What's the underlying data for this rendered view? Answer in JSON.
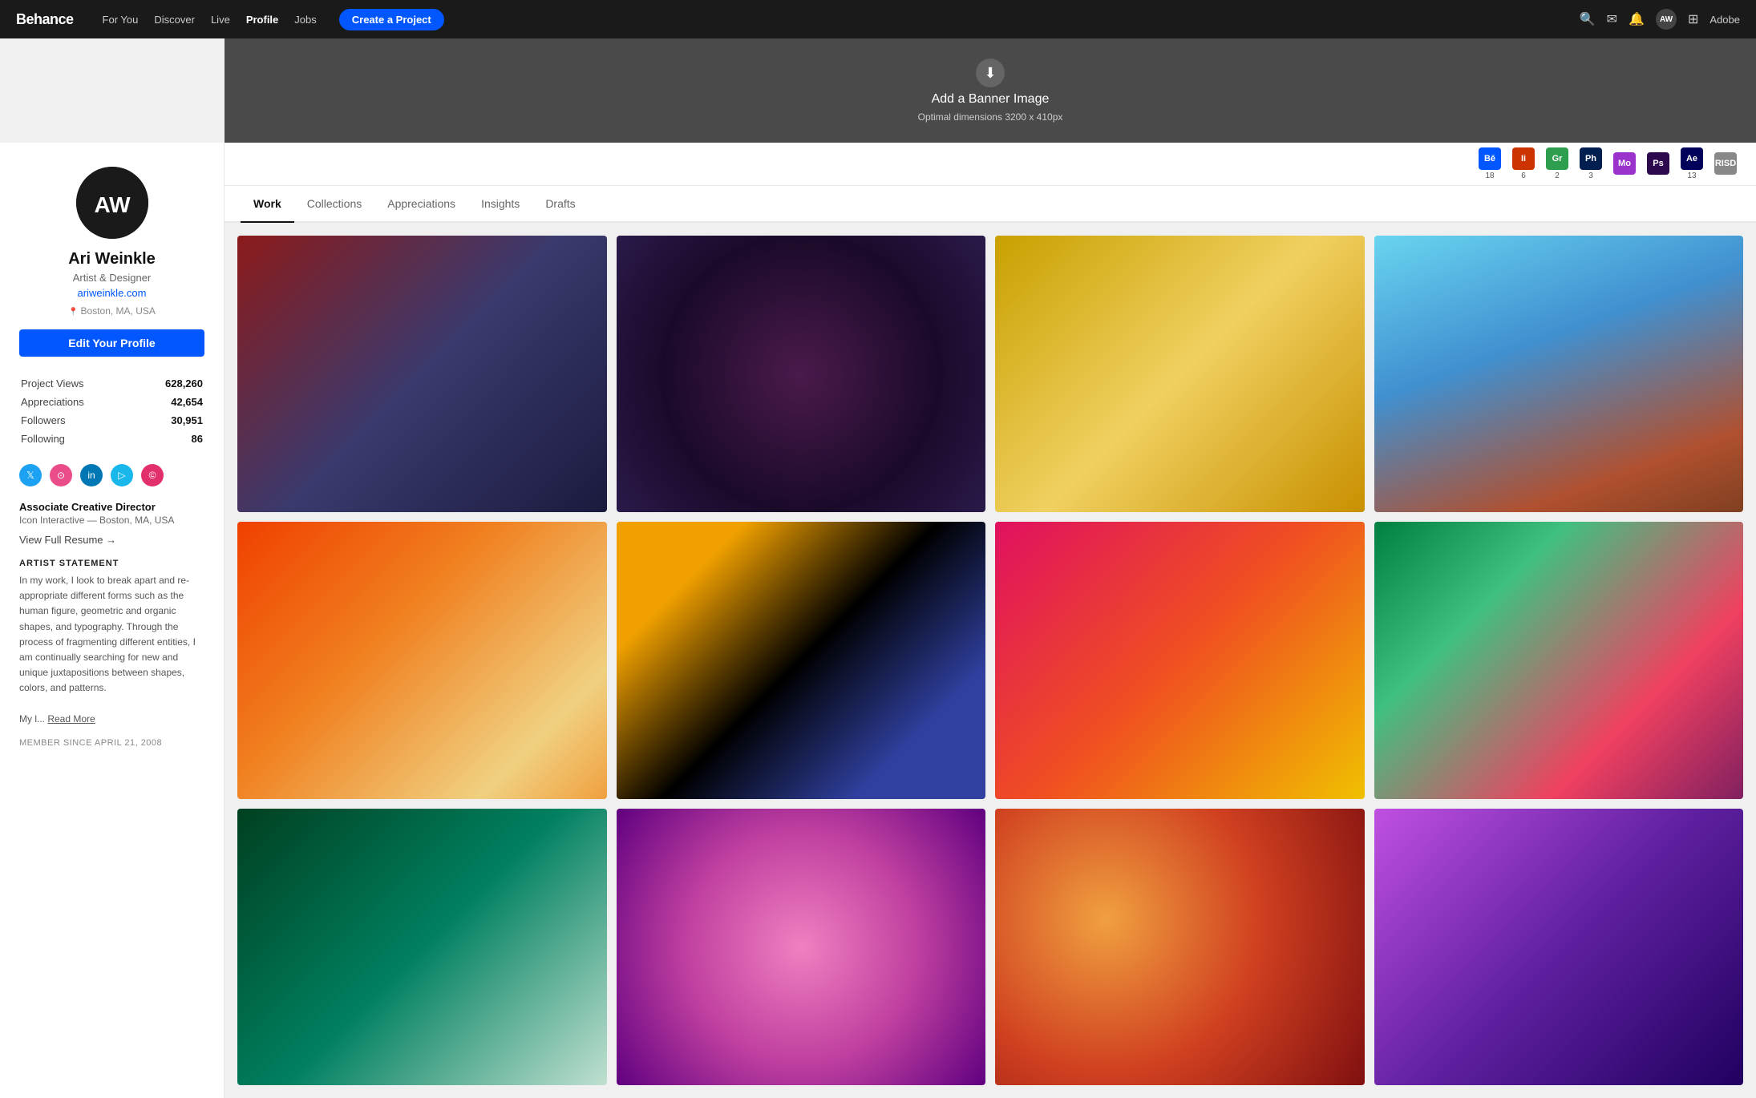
{
  "nav": {
    "brand": "Behance",
    "links": [
      {
        "label": "For You",
        "active": false
      },
      {
        "label": "Discover",
        "active": false
      },
      {
        "label": "Live",
        "active": false
      },
      {
        "label": "Profile",
        "active": true
      },
      {
        "label": "Jobs",
        "active": false
      }
    ],
    "cta": "Create a Project",
    "adobe": "Adobe"
  },
  "banner": {
    "title": "Add a Banner Image",
    "subtitle": "Optimal dimensions 3200 x 410px"
  },
  "sidebar": {
    "avatar_initials": "AW",
    "name": "Ari Weinkle",
    "role": "Artist & Designer",
    "website": "ariweinkle.com",
    "location": "Boston, MA, USA",
    "edit_profile_label": "Edit Your Profile",
    "stats": [
      {
        "label": "Project Views",
        "value": "628,260"
      },
      {
        "label": "Appreciations",
        "value": "42,654"
      },
      {
        "label": "Followers",
        "value": "30,951"
      },
      {
        "label": "Following",
        "value": "86"
      }
    ],
    "social_icons": [
      "𝕏",
      "⊙",
      "in",
      "▷",
      "©"
    ],
    "job_title": "Associate Creative Director",
    "job_company": "Icon Interactive — Boston, MA, USA",
    "resume_link": "View Full Resume →",
    "artist_statement_title": "ARTIST STATEMENT",
    "artist_statement": "In my work, I look to break apart and re-appropriate different forms such as the human figure, geometric and organic shapes, and typography. Through the process of fragmenting different entities, I am continually searching for new and unique juxtapositions between shapes, colors, and patterns.\n\nMy l...",
    "read_more": "Read More",
    "member_since": "MEMBER SINCE APRIL 21, 2008"
  },
  "badges": [
    {
      "label": "Bē",
      "color": "#0057ff",
      "count": "18"
    },
    {
      "label": "Ii",
      "color": "#cc3300",
      "count": "6"
    },
    {
      "label": "Gr",
      "color": "#00aa44",
      "count": "2"
    },
    {
      "label": "Ph",
      "color": "#0044cc",
      "count": "3"
    },
    {
      "label": "Mo",
      "color": "#9933cc",
      "count": ""
    },
    {
      "label": "Ps",
      "color": "#001e50",
      "count": ""
    },
    {
      "label": "Ae",
      "color": "#00005b",
      "count": "13"
    },
    {
      "label": "RISD",
      "color": "#888888",
      "count": ""
    }
  ],
  "tabs": [
    {
      "label": "Work",
      "active": true
    },
    {
      "label": "Collections",
      "active": false
    },
    {
      "label": "Appreciations",
      "active": false
    },
    {
      "label": "Insights",
      "active": false
    },
    {
      "label": "Drafts",
      "active": false
    }
  ],
  "portfolio": {
    "items": [
      {
        "class": "pi-1"
      },
      {
        "class": "pi-2"
      },
      {
        "class": "pi-3"
      },
      {
        "class": "pi-4"
      },
      {
        "class": "pi-5"
      },
      {
        "class": "pi-6"
      },
      {
        "class": "pi-7"
      },
      {
        "class": "pi-8"
      },
      {
        "class": "pi-9"
      },
      {
        "class": "pi-10"
      },
      {
        "class": "pi-11"
      },
      {
        "class": "pi-12"
      }
    ]
  }
}
